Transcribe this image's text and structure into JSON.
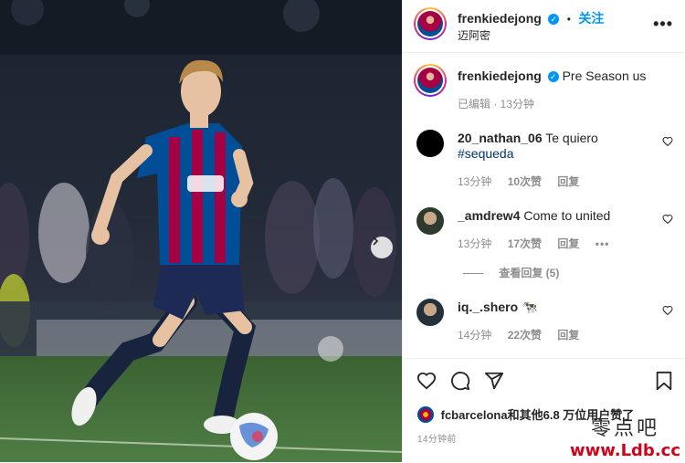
{
  "header": {
    "username": "frenkiedejong",
    "follow_label": "关注",
    "location": "迈阿密",
    "more_label": "•••"
  },
  "caption": {
    "username": "frenkiedejong",
    "text": "Pre Season us",
    "meta": "已编辑 · 13分钟"
  },
  "comments": [
    {
      "username": "20_nathan_06",
      "text": "Te quiero",
      "hashtag": "#sequeda",
      "time": "13分钟",
      "likes": "10次赞",
      "reply": "回复"
    },
    {
      "username": "_amdrew4",
      "text": "Come to united",
      "time": "13分钟",
      "likes": "17次赞",
      "reply": "回复",
      "more": "•••",
      "view_replies": "查看回复 (5)"
    },
    {
      "username": "iq._.shero",
      "text": "🐄",
      "time": "14分钟",
      "likes": "22次赞",
      "reply": "回复"
    }
  ],
  "likes": {
    "text": "fcbarcelona和其他6.8 万位用户赞了"
  },
  "posted": "14分钟前",
  "watermark": {
    "zh": "零点吧",
    "url": "www.Ldb.cc"
  },
  "colors": {
    "accent": "#0095f6",
    "barca_blue": "#004d98",
    "barca_red": "#a50044"
  }
}
